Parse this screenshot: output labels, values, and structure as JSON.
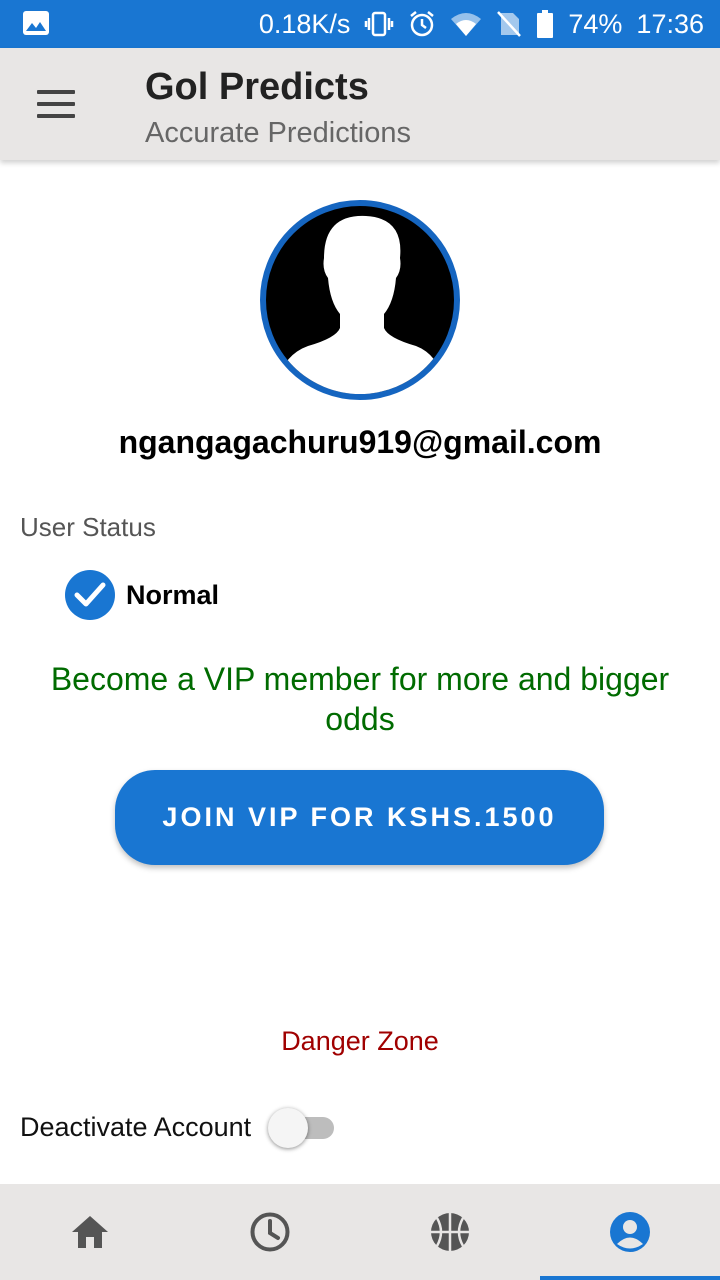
{
  "status_bar": {
    "net_speed": "0.18K/s",
    "battery": "74%",
    "time": "17:36"
  },
  "app_bar": {
    "title": "Gol Predicts",
    "subtitle": "Accurate Predictions"
  },
  "profile": {
    "email": "ngangagachuru919@gmail.com",
    "user_status_label": "User Status",
    "status": "Normal"
  },
  "vip": {
    "promo_text": "Become a VIP member for more and bigger odds",
    "button_label": "JOIN VIP FOR KSHS.1500"
  },
  "danger": {
    "title": "Danger Zone",
    "deactivate_label": "Deactivate Account",
    "deactivate_on": false
  },
  "bottom_nav": {
    "items": [
      {
        "icon": "home-icon",
        "active": false
      },
      {
        "icon": "clock-icon",
        "active": false
      },
      {
        "icon": "basketball-icon",
        "active": false
      },
      {
        "icon": "account-icon",
        "active": true
      }
    ]
  },
  "colors": {
    "primary": "#1976d2",
    "promo_green": "#006b00",
    "danger_red": "#a00000"
  }
}
